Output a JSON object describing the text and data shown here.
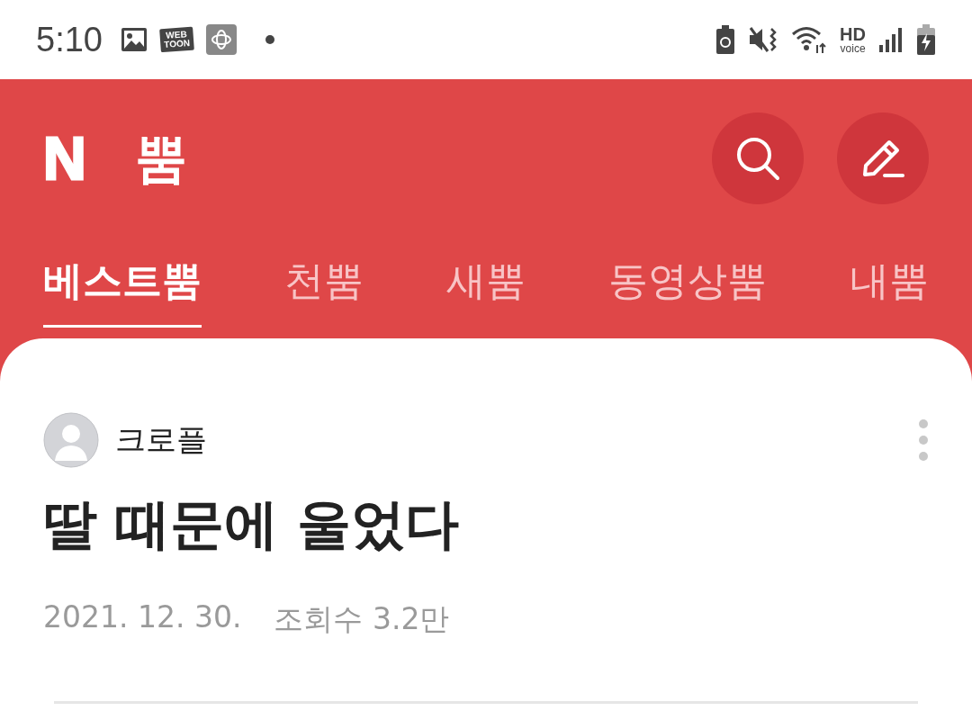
{
  "status_bar": {
    "time": "5:10",
    "webtoon_badge": [
      "WEB",
      "TOON"
    ],
    "hd_voice": [
      "HD",
      "voice"
    ]
  },
  "header": {
    "logo_letter": "N",
    "logo_text": "뿜"
  },
  "tabs": [
    {
      "label": "베스트뿜",
      "selected": true
    },
    {
      "label": "천뿜",
      "selected": false
    },
    {
      "label": "새뿜",
      "selected": false
    },
    {
      "label": "동영상뿜",
      "selected": false
    },
    {
      "label": "내뿜",
      "selected": false
    }
  ],
  "post": {
    "author": "크로플",
    "title": "딸 때문에 울었다",
    "date": "2021. 12. 30.",
    "views": "조회수 3.2만"
  }
}
